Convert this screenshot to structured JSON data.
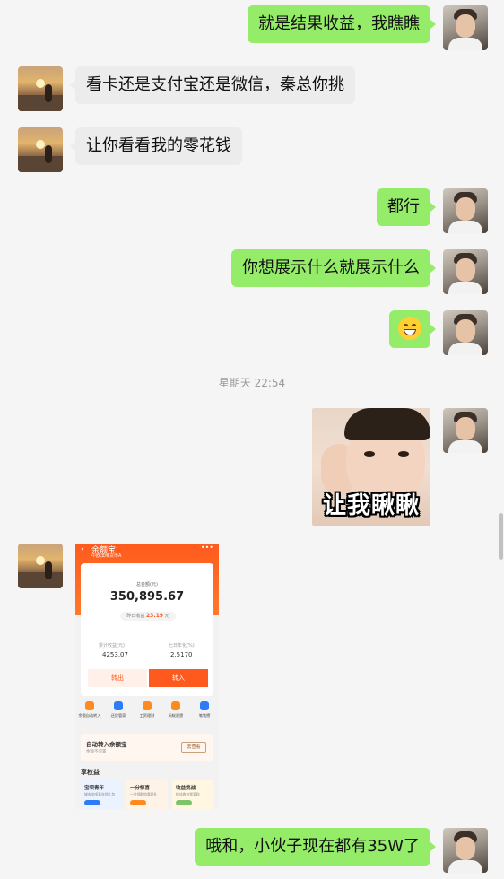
{
  "messages": [
    {
      "side": "me",
      "text": "就是结果收益，我瞧瞧"
    },
    {
      "side": "other",
      "text": "看卡还是支付宝还是微信，秦总你挑"
    },
    {
      "side": "other",
      "text": "让你看看我的零花钱"
    },
    {
      "side": "me",
      "text": "都行"
    },
    {
      "side": "me",
      "text": "你想展示什么就展示什么"
    },
    {
      "side": "me",
      "emoji": "grinning-face"
    },
    {
      "timestamp": "星期天 22:54"
    },
    {
      "side": "me",
      "sticker_caption": "让我瞅瞅"
    },
    {
      "side": "other",
      "screenshot": "yuebao"
    },
    {
      "side": "me",
      "text": "哦和，小伙子现在都有35W了"
    }
  ],
  "timestamp": "星期天 22:54",
  "sticker": {
    "caption": "让我瞅瞅"
  },
  "yuebao": {
    "title": "余额宝",
    "subtitle": "中欧滨维货币A",
    "total_label": "总金额(元)",
    "amount": "350,895.67",
    "yesterday_label": "昨日收益",
    "yesterday_value": "23.19",
    "yesterday_unit": "元",
    "k1_label": "累计收益(元)",
    "k1_value": "4253.07",
    "k2_label": "七日年化(%)",
    "k2_value": "2.5170",
    "btn_out": "转出",
    "btn_in": "转入",
    "icons": [
      "余额自动转入",
      "还贷管家",
      "工资理财",
      "蚂蚁星愿",
      "笔笔攒"
    ],
    "icon_colors": [
      "#ff8a1e",
      "#2d7cf6",
      "#ff8a1e",
      "#ff8a1e",
      "#2d7cf6"
    ],
    "promo_title": "自动转入余额宝",
    "promo_sub": "余额不闲置",
    "promo_btn": "去查看",
    "rights_title": "享权益",
    "rights": [
      {
        "title": "宝呗青年",
        "sub": "城市宝呗青年领礼包",
        "color": "#eaf3ff",
        "pill": "#2d7cf6"
      },
      {
        "title": "一分惊喜",
        "sub": "一分领取惊喜好礼",
        "color": "#fff2e6",
        "pill": "#ff8a1e"
      },
      {
        "title": "收益挑战",
        "sub": "挑战收益领奖励",
        "color": "#fff7e2",
        "pill": "#7bc46a"
      }
    ]
  },
  "colors": {
    "my_bubble": "#95ec69",
    "other_bubble": "#ececec",
    "brand": "#ff5a1e"
  }
}
